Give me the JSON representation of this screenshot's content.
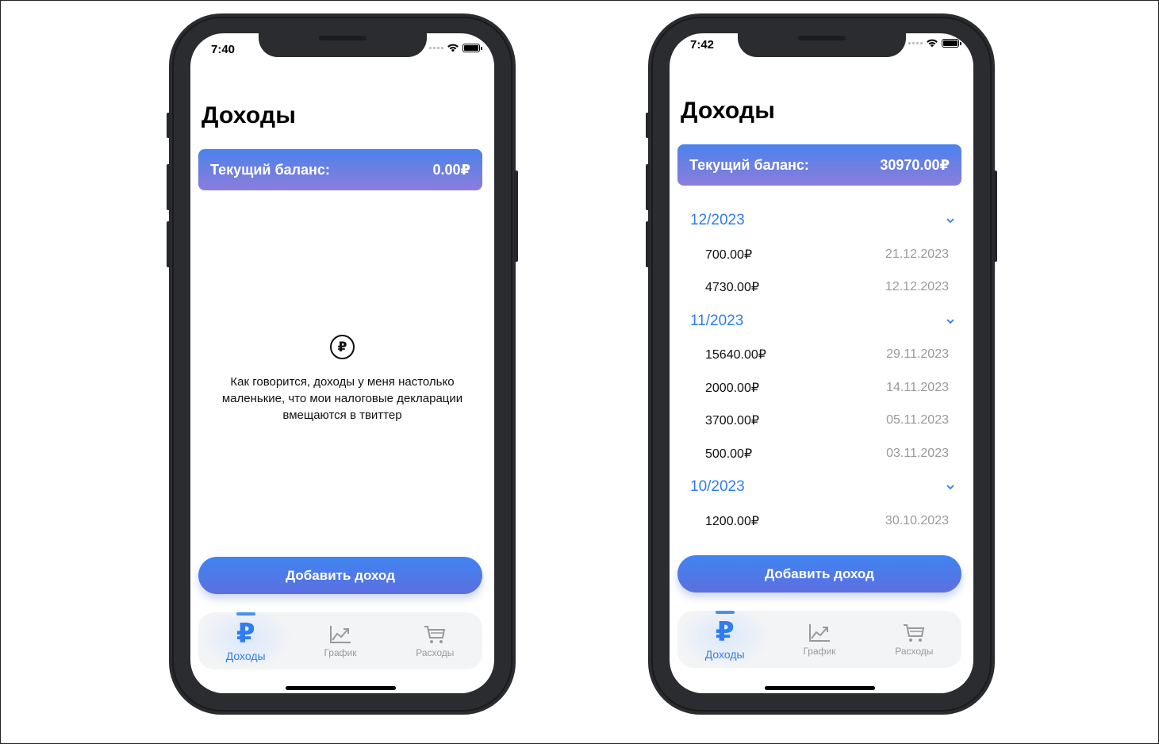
{
  "left": {
    "status_time": "7:40",
    "title": "Доходы",
    "balance_label": "Текущий баланс:",
    "balance_value": "0.00₽",
    "empty_icon": "ruble-circle-icon",
    "empty_icon_glyph": "₽",
    "empty_text": "Как говорится, доходы у меня настолько маленькие, что мои налоговые декларации вмещаются в твиттер",
    "add_button": "Добавить доход",
    "tabs": [
      {
        "label": "Доходы",
        "icon": "ruble-icon",
        "active": true
      },
      {
        "label": "График",
        "icon": "chart-icon",
        "active": false
      },
      {
        "label": "Расходы",
        "icon": "cart-icon",
        "active": false
      }
    ]
  },
  "right": {
    "status_time": "7:42",
    "title": "Доходы",
    "balance_label": "Текущий баланс:",
    "balance_value": "30970.00₽",
    "groups": [
      {
        "month": "12/2023",
        "items": [
          {
            "amount": "700.00₽",
            "date": "21.12.2023"
          },
          {
            "amount": "4730.00₽",
            "date": "12.12.2023"
          }
        ]
      },
      {
        "month": "11/2023",
        "items": [
          {
            "amount": "15640.00₽",
            "date": "29.11.2023"
          },
          {
            "amount": "2000.00₽",
            "date": "14.11.2023"
          },
          {
            "amount": "3700.00₽",
            "date": "05.11.2023"
          },
          {
            "amount": "500.00₽",
            "date": "03.11.2023"
          }
        ]
      },
      {
        "month": "10/2023",
        "items": [
          {
            "amount": "1200.00₽",
            "date": "30.10.2023"
          }
        ]
      }
    ],
    "add_button": "Добавить доход",
    "tabs": [
      {
        "label": "Доходы",
        "icon": "ruble-icon",
        "active": true
      },
      {
        "label": "График",
        "icon": "chart-icon",
        "active": false
      },
      {
        "label": "Расходы",
        "icon": "cart-icon",
        "active": false
      }
    ]
  },
  "colors": {
    "accent": "#2f7df0",
    "balance_gradient_top": "#4b82ef",
    "balance_gradient_bottom": "#8a7edd",
    "phone_body": "#2a2c2f"
  }
}
